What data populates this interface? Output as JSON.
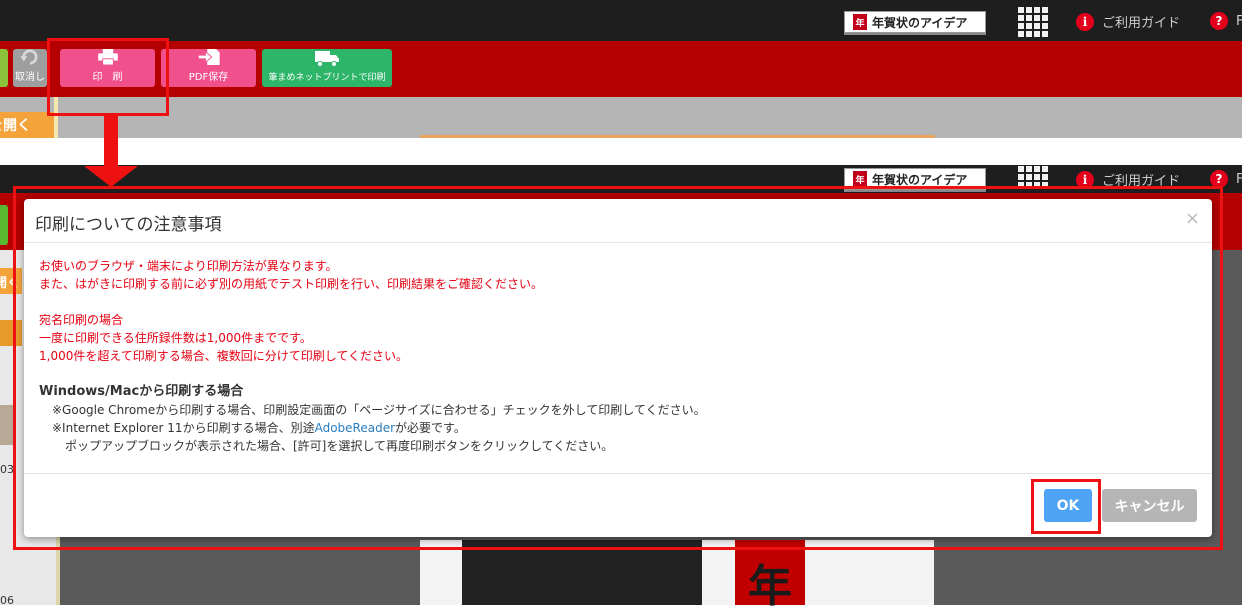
{
  "header": {
    "idea_label": "年賀状のアイデア",
    "guide_label": "ご利用ガイド",
    "cut_label": "F"
  },
  "toolbar": {
    "undo_label": "取消し",
    "print_label": "印　刷",
    "pdf_label": "PDF保存",
    "netprint_label": "筆まめネットプリントで印刷",
    "colors": {
      "print": "#f0508c",
      "pdf": "#f0508c",
      "netprint": "#2db56a",
      "undo": "#9e9e9e"
    }
  },
  "left_panel": {
    "open_label": "開く",
    "open_label_short": "を開く",
    "num_1": "03",
    "num_2": "06"
  },
  "dialog": {
    "title": "印刷についての注意事項",
    "close_glyph": "×",
    "red_lines": [
      "お使いのブラウザ・端末により印刷方法が異なります。",
      "また、はがきに印刷する前に必ず別の用紙でテスト印刷を行い、印刷結果をご確認ください。"
    ],
    "addr_head": "宛名印刷の場合",
    "addr_lines": [
      "一度に印刷できる住所録件数は1,000件までです。",
      "1,000件を超えて印刷する場合、複数回に分けて印刷してください。"
    ],
    "os_head": "Windows/Macから印刷する場合",
    "chrome_note": "※Google Chromeから印刷する場合、印刷設定画面の「ページサイズに合わせる」チェックを外して印刷してください。",
    "ie_note_prefix": "※Internet Explorer 11から印刷する場合、別途",
    "ie_link": "AdobeReader",
    "ie_note_suffix": "が必要です。",
    "popup_note": "ポップアップブロックが表示された場合、[許可]を選択して再度印刷ボタンをクリックしてください。",
    "ok_label": "OK",
    "cancel_label": "キャンセル"
  },
  "background": {
    "card_glyph": "年"
  },
  "annotation_color": "#ee1111"
}
